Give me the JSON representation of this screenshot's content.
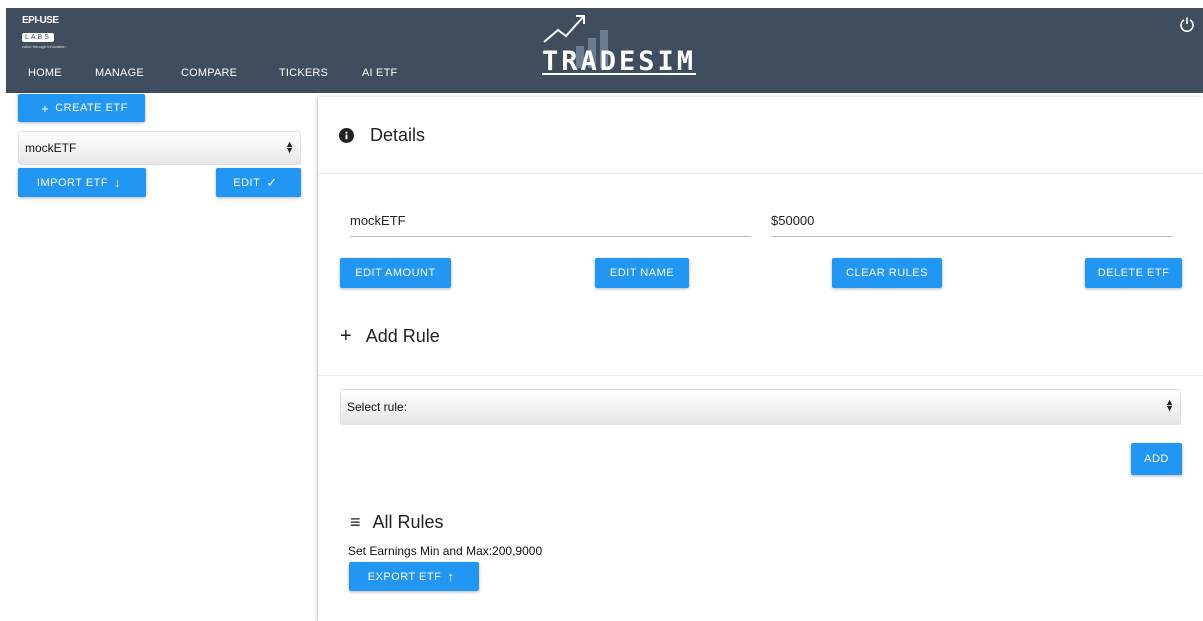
{
  "header": {
    "logo": {
      "line1": "EPI-USE",
      "line2": "LABS",
      "line3": "value through innovation"
    },
    "brand": "TRADESIM",
    "nav": [
      "HOME",
      "MANAGE",
      "COMPARE",
      "TICKERS",
      "AI ETF"
    ],
    "power_icon": "power-icon"
  },
  "sidebar": {
    "create_label": "CREATE ETF",
    "create_icon": "plus-icon",
    "etf_select_value": "mockETF",
    "import_label": "IMPORT ETF",
    "import_icon": "arrow-down-icon",
    "edit_label": "EDIT",
    "edit_icon": "check-icon"
  },
  "details": {
    "title": "Details",
    "icon": "info-icon",
    "name_value": "mockETF",
    "amount_value": "$50000",
    "edit_amount_label": "EDIT AMOUNT",
    "edit_name_label": "EDIT NAME",
    "clear_rules_label": "CLEAR RULES",
    "delete_label": "DELETE ETF"
  },
  "add_rule": {
    "title": "Add Rule",
    "icon": "plus-icon",
    "select_value": "Select rule:",
    "add_label": "ADD"
  },
  "all_rules": {
    "title": "All Rules",
    "icon": "menu-icon",
    "rules": [
      "Set Earnings Min and Max:200,9000"
    ],
    "export_label": "EXPORT ETF",
    "export_icon": "arrow-up-icon"
  },
  "colors": {
    "header_bg": "#3f4d5e",
    "accent": "#2196f3"
  }
}
